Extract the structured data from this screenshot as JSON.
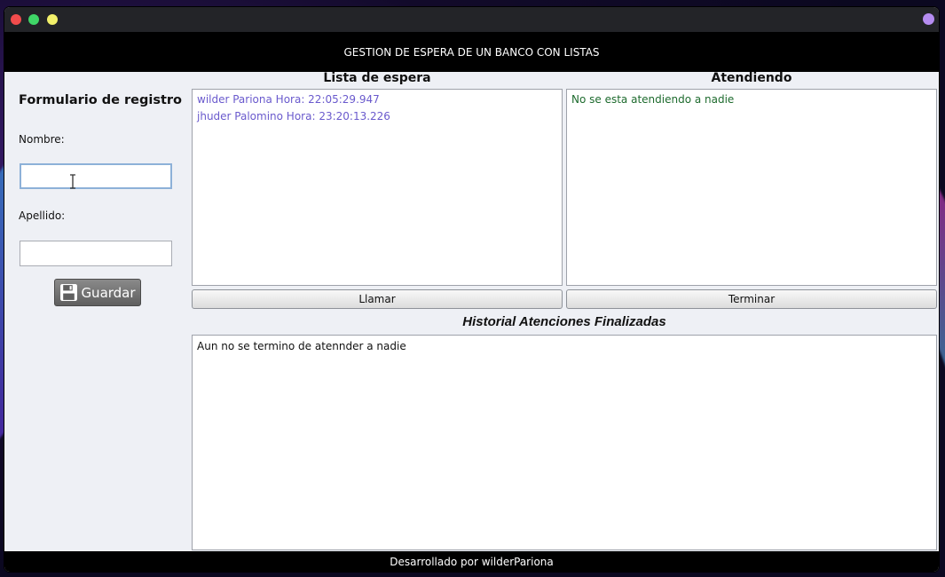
{
  "window": {
    "header_title": "GESTION DE ESPERA DE UN BANCO CON LISTAS",
    "footer_text": "Desarrollado por wilderPariona"
  },
  "form": {
    "title": "Formulario de registro",
    "nombre_label": "Nombre:",
    "nombre_value": "",
    "apellido_label": "Apellido:",
    "apellido_value": "",
    "save_label": "Guardar",
    "save_icon": "floppy-disk-icon"
  },
  "waiting_list": {
    "title": "Lista de espera",
    "items": [
      "wilder Pariona Hora: 22:05:29.947",
      "jhuder Palomino Hora: 23:20:13.226"
    ],
    "text_color": "#6a5acd",
    "call_label": "Llamar"
  },
  "attending": {
    "title": "Atendiendo",
    "items": [
      "No se esta atendiendo a nadie"
    ],
    "text_color": "#1e6b2e",
    "finish_label": "Terminar"
  },
  "history": {
    "title": "Historial Atenciones Finalizadas",
    "items": [
      "Aun no se termino de atennder a nadie"
    ]
  },
  "colors": {
    "header_bg": "#000000",
    "panel_bg": "#eef0f5",
    "titlebar_bg": "#232428"
  }
}
